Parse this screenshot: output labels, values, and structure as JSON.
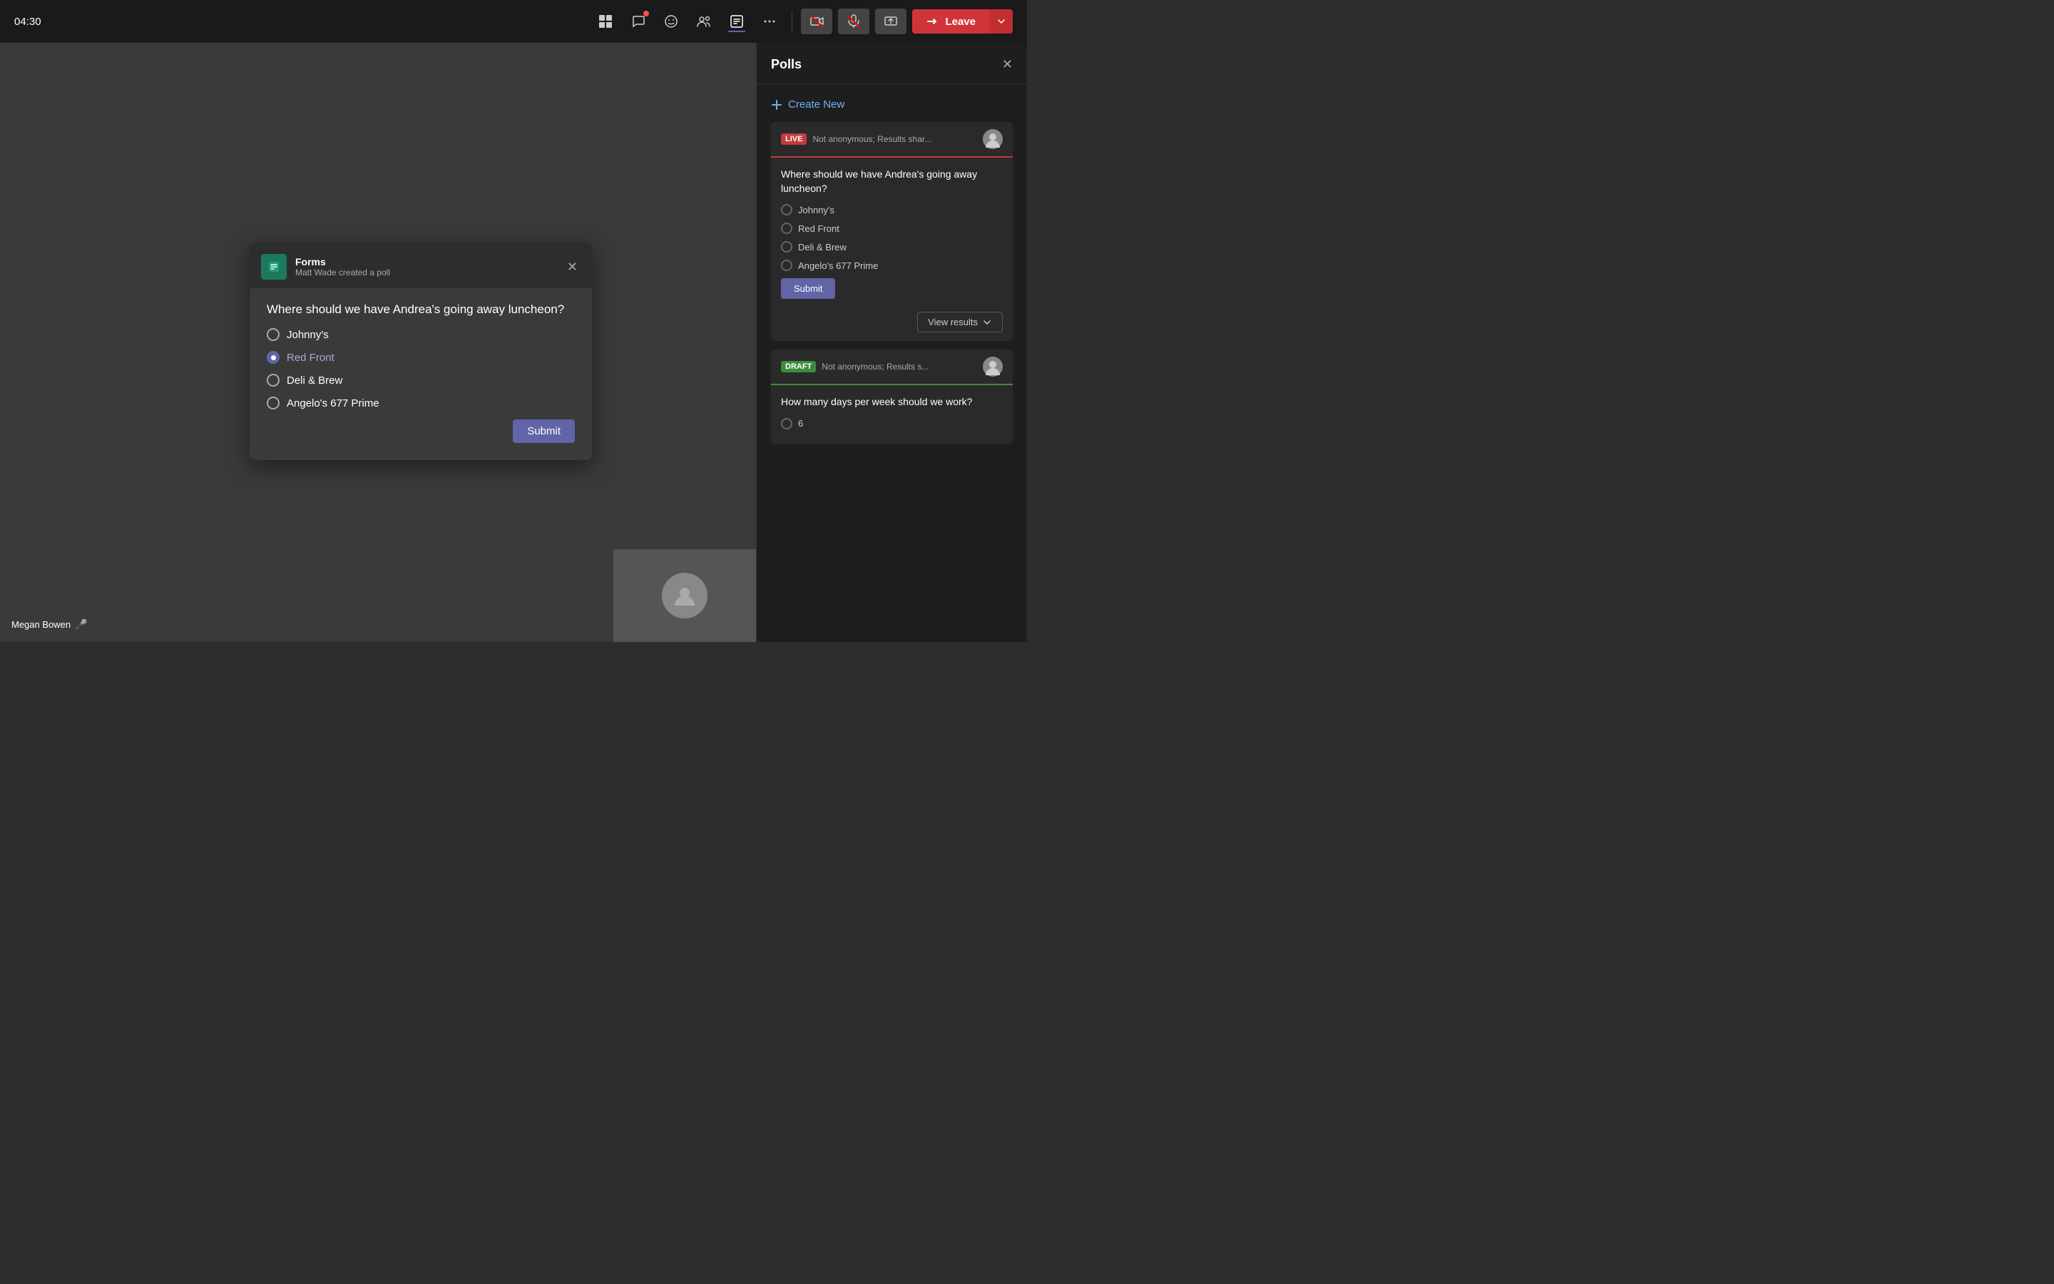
{
  "topbar": {
    "time": "04:30",
    "icons": [
      {
        "name": "view-switcher-icon",
        "symbol": "⊞",
        "hasBadge": false
      },
      {
        "name": "chat-icon",
        "symbol": "💬",
        "hasBadge": true
      },
      {
        "name": "emoji-icon",
        "symbol": "😊",
        "hasBadge": false
      },
      {
        "name": "participants-icon",
        "symbol": "👥",
        "hasBadge": false
      },
      {
        "name": "forms-icon",
        "symbol": "📋",
        "hasBadge": false,
        "active": true
      },
      {
        "name": "more-icon",
        "symbol": "•••",
        "hasBadge": false
      }
    ],
    "mute_camera": "📷",
    "mute_mic": "🎤",
    "share": "⬆",
    "leave_label": "Leave"
  },
  "poll_popup": {
    "source": "Forms",
    "subtitle": "Matt Wade created a poll",
    "question": "Where should we have Andrea's going away luncheon?",
    "options": [
      {
        "label": "Johnny's",
        "selected": false
      },
      {
        "label": "Red Front",
        "selected": true
      },
      {
        "label": "Deli & Brew",
        "selected": false
      },
      {
        "label": "Angelo's 677 Prime",
        "selected": false
      }
    ],
    "submit_label": "Submit"
  },
  "participant": {
    "name": "Megan Bowen"
  },
  "polls_panel": {
    "title": "Polls",
    "close_icon": "✕",
    "create_new_label": "Create New",
    "live_poll": {
      "badge": "LIVE",
      "meta": "Not anonymous; Results shar...",
      "question": "Where should we have Andrea's going away luncheon?",
      "options": [
        {
          "label": "Johnny's"
        },
        {
          "label": "Red Front"
        },
        {
          "label": "Deli & Brew"
        },
        {
          "label": "Angelo's 677 Prime"
        }
      ],
      "submit_label": "Submit",
      "view_results_label": "View results"
    },
    "draft_poll": {
      "badge": "DRAFT",
      "meta": "Not anonymous; Results s...",
      "question": "How many days per week should we work?",
      "options": [
        {
          "label": "6"
        }
      ]
    }
  }
}
